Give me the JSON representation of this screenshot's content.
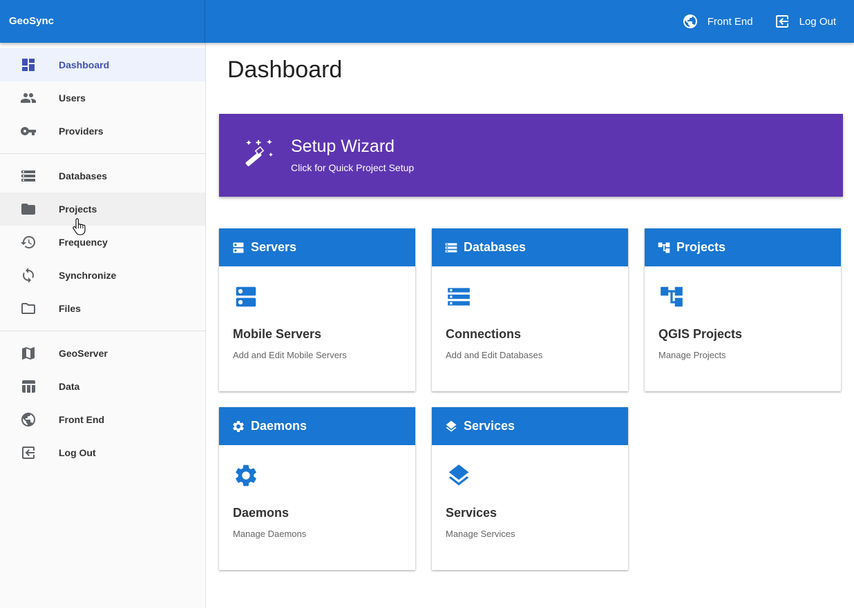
{
  "app": {
    "brand": "GeoSync"
  },
  "topbar": {
    "actions": [
      {
        "label": "Front End",
        "icon": "globe-icon"
      },
      {
        "label": "Log Out",
        "icon": "logout-icon"
      }
    ]
  },
  "sidebar": {
    "groups": [
      [
        {
          "label": "Dashboard",
          "icon": "dashboard-icon",
          "active": true
        },
        {
          "label": "Users",
          "icon": "users-icon"
        },
        {
          "label": "Providers",
          "icon": "key-icon"
        }
      ],
      [
        {
          "label": "Databases",
          "icon": "database-list-icon"
        },
        {
          "label": "Projects",
          "icon": "folder-icon",
          "hovered": true
        },
        {
          "label": "Frequency",
          "icon": "history-icon"
        },
        {
          "label": "Synchronize",
          "icon": "sync-icon"
        },
        {
          "label": "Files",
          "icon": "folder-open-icon"
        }
      ],
      [
        {
          "label": "GeoServer",
          "icon": "map-icon"
        },
        {
          "label": "Data",
          "icon": "table-icon"
        },
        {
          "label": "Front End",
          "icon": "globe-icon"
        },
        {
          "label": "Log Out",
          "icon": "logout-icon"
        }
      ]
    ]
  },
  "main": {
    "title": "Dashboard",
    "wizard": {
      "title": "Setup Wizard",
      "subtitle": "Click for Quick Project Setup",
      "icon": "magic-wand-icon"
    },
    "cards": [
      {
        "header": "Servers",
        "icon": "server-icon",
        "title": "Mobile Servers",
        "description": "Add and Edit Mobile Servers"
      },
      {
        "header": "Databases",
        "icon": "database-list-icon",
        "title": "Connections",
        "description": "Add and Edit Databases"
      },
      {
        "header": "Projects",
        "icon": "project-tree-icon",
        "title": "QGIS Projects",
        "description": "Manage Projects"
      },
      {
        "header": "Daemons",
        "icon": "gear-icon",
        "title": "Daemons",
        "description": "Manage Daemons"
      },
      {
        "header": "Services",
        "icon": "layers-icon",
        "title": "Services",
        "description": "Manage Services"
      }
    ]
  },
  "colors": {
    "primary": "#1976d2",
    "wizard": "#5e35b1",
    "active_nav": "#3f51b5"
  }
}
